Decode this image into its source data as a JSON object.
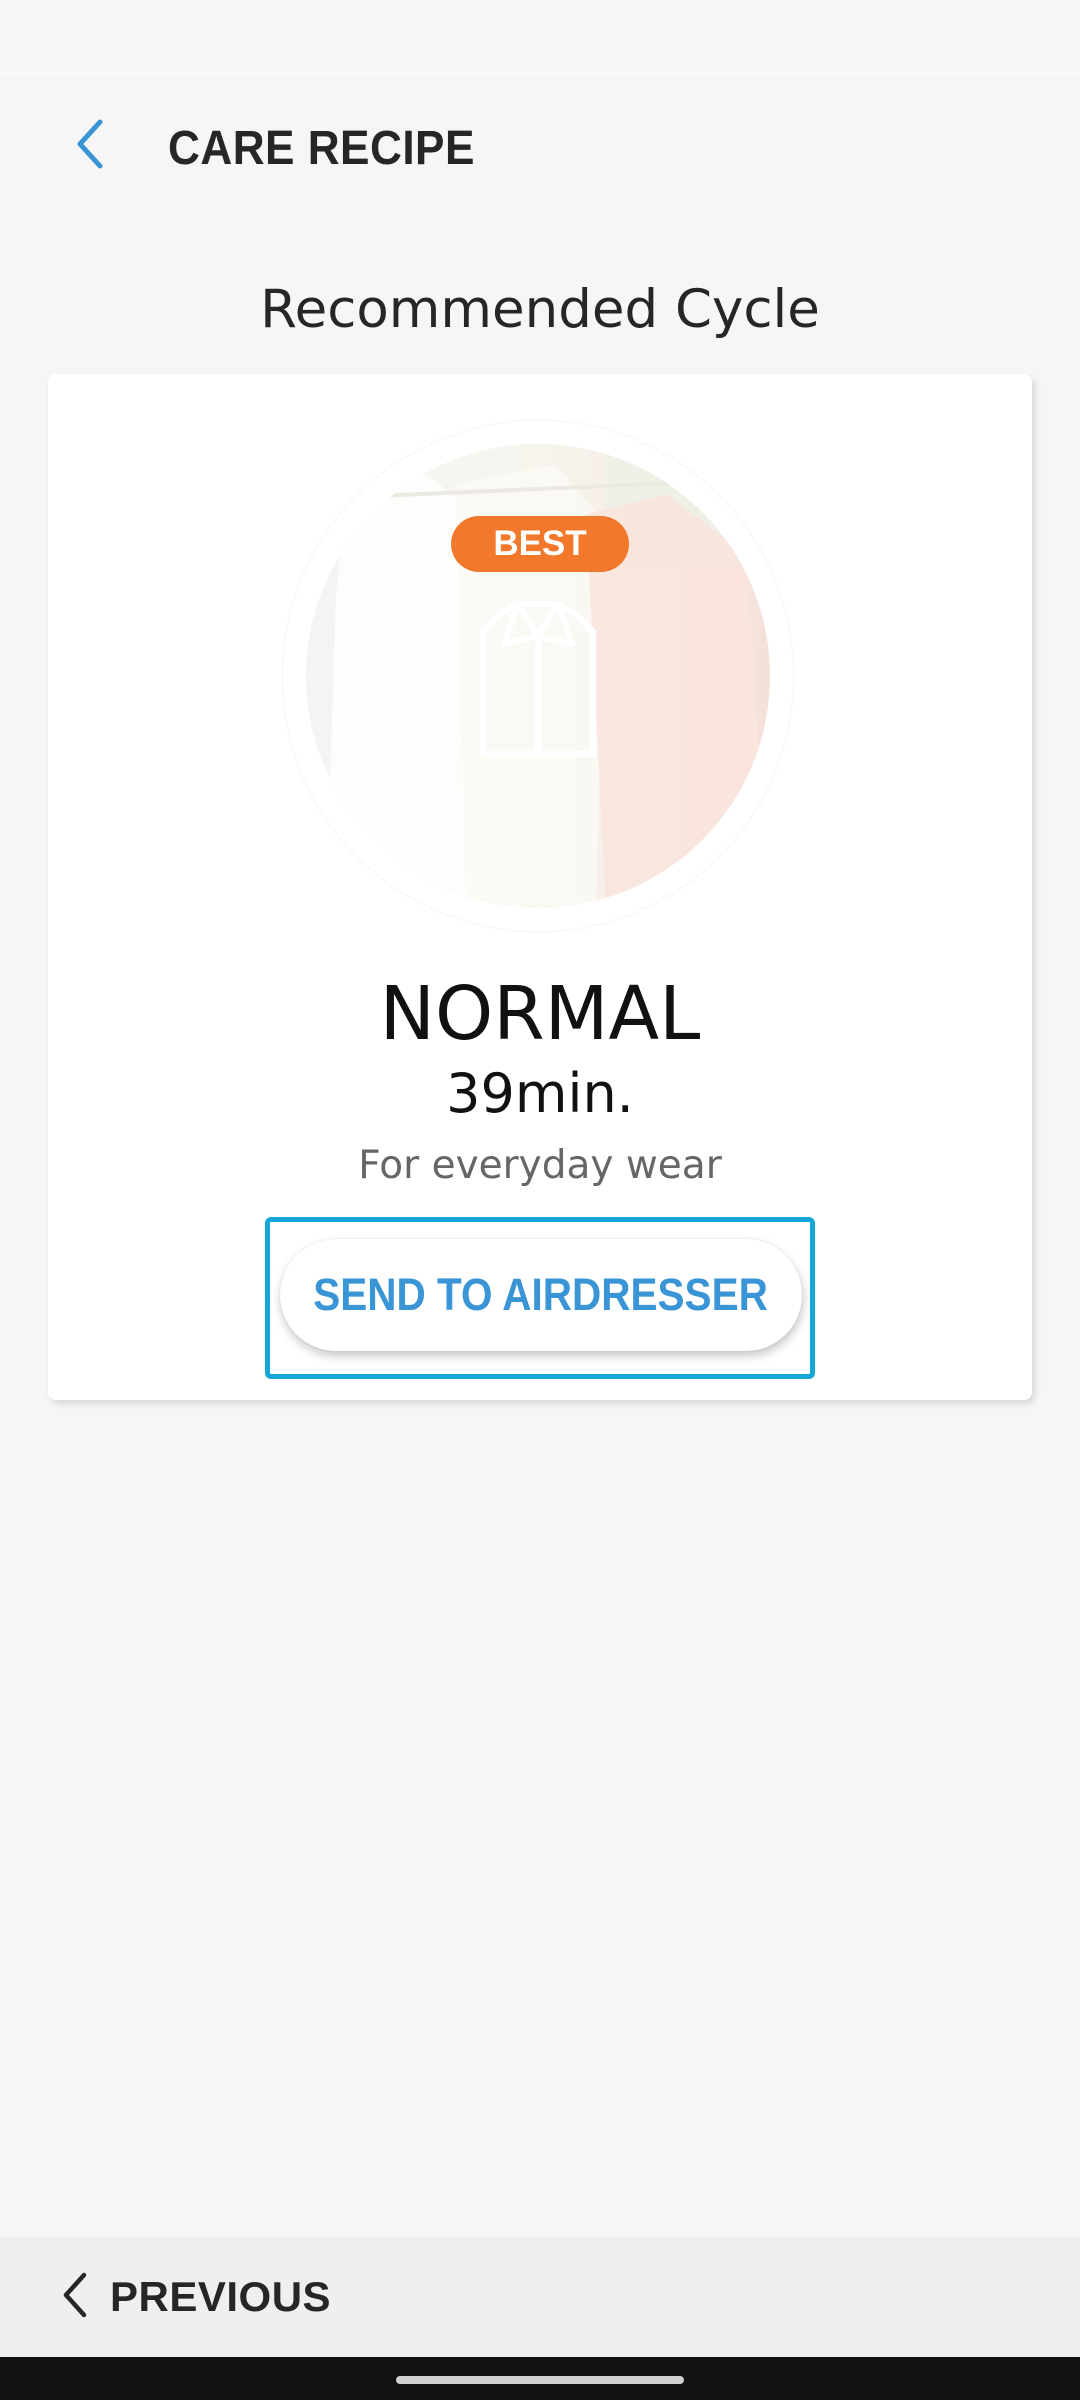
{
  "header": {
    "title": "CARE RECIPE",
    "back_icon": "chevron-left-icon",
    "accent_color": "#3a95d6"
  },
  "section": {
    "title": "Recommended Cycle"
  },
  "recommendation": {
    "badge": "BEST",
    "badge_color": "#f2792c",
    "garment_icon": "shirt-icon",
    "cycle_name": "NORMAL",
    "duration": "39min.",
    "description": "For everyday wear",
    "send_label": "SEND TO AIRDRESSER",
    "highlight_color": "#15a8d6"
  },
  "footer": {
    "previous_label": "PREVIOUS",
    "previous_icon": "chevron-left-icon"
  }
}
